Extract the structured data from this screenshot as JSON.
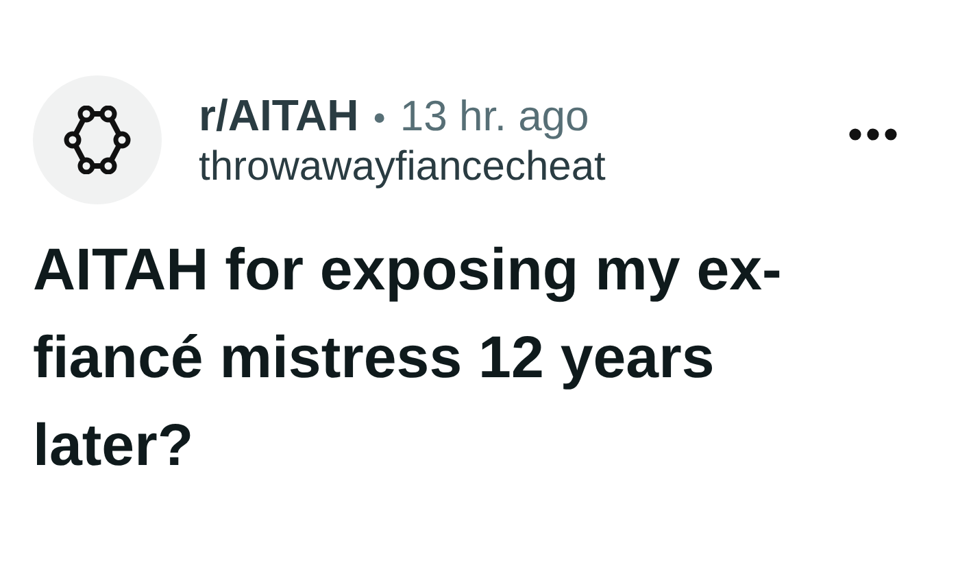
{
  "post": {
    "community": "r/AITAH",
    "separator": "•",
    "time": "13 hr. ago",
    "author": "throwawayfiancecheat",
    "title": "AITAH for exposing my ex-fiancé mistress 12 years later?"
  }
}
